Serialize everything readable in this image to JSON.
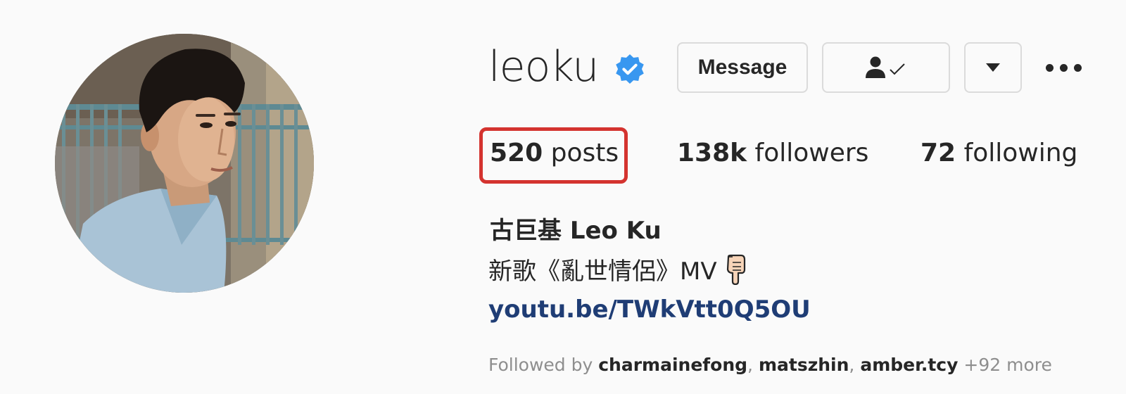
{
  "profile": {
    "username": "leoku",
    "verified": true,
    "full_name": "古巨基 Leo Ku",
    "bio_text": "新歌《亂世情侶》MV",
    "bio_emoji": "backhand-index-pointing-down-icon",
    "link": "youtu.be/TWkVtt0Q5OU"
  },
  "actions": {
    "message_label": "Message",
    "following_icon": "person-check-icon",
    "dropdown_icon": "caret-down-icon",
    "more_icon": "more-options-icon"
  },
  "stats": {
    "posts_count": "520",
    "posts_label": "posts",
    "followers_count": "138k",
    "followers_label": "followers",
    "following_count": "72",
    "following_label": "following"
  },
  "followed_by": {
    "prefix": "Followed by",
    "users": [
      "charmainefong",
      "matszhin",
      "amber.tcy"
    ],
    "more": "+92 more"
  },
  "colors": {
    "highlight_border": "#d4332f",
    "verified_blue": "#3897f0",
    "link_color": "#1f3d75"
  }
}
